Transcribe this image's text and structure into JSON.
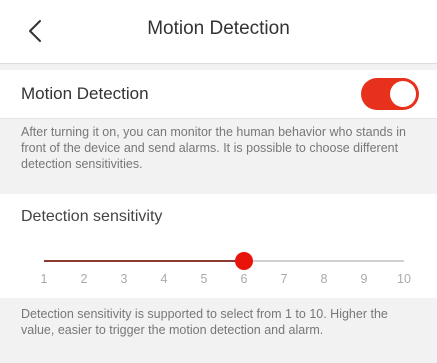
{
  "header": {
    "title": "Motion Detection",
    "back_icon": "chevron-left-icon"
  },
  "motion": {
    "label": "Motion Detection",
    "enabled": true,
    "toggle_color": "#e8311d",
    "description": "After turning it on, you can monitor the human behavior who stands in front of the device and send alarms. It is possible to choose different detection sensitivities."
  },
  "sensitivity": {
    "label": "Detection sensitivity",
    "value": 6,
    "min": 1,
    "max": 10,
    "ticks": [
      "1",
      "2",
      "3",
      "4",
      "5",
      "6",
      "7",
      "8",
      "9",
      "10"
    ],
    "thumb_color": "#e8140c",
    "fill_color": "#8c3a30",
    "description": "Detection sensitivity is supported to select from 1 to 10. Higher the value, easier to trigger the motion detection and alarm."
  }
}
